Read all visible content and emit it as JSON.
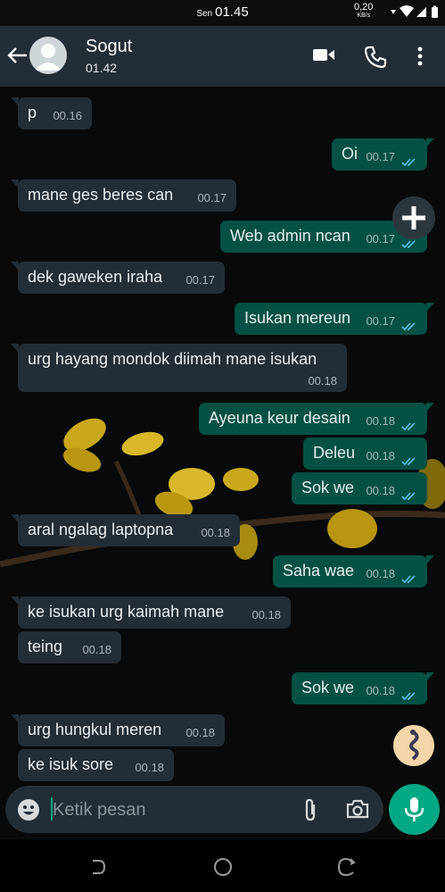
{
  "status_bar": {
    "day": "Sen",
    "time": "01.45",
    "speed_value": "0,20",
    "speed_unit": "KB/s"
  },
  "header": {
    "back_icon": "arrow-left-icon",
    "contact_name": "Sogut",
    "last_seen": "01.42",
    "icons": [
      "video-call-icon",
      "voice-call-icon",
      "more-vert-icon"
    ]
  },
  "messages": [
    {
      "dir": "in",
      "text": "p",
      "time": "00.16"
    },
    {
      "dir": "out",
      "text": "Oi",
      "time": "00.17",
      "read": true
    },
    {
      "dir": "in",
      "text": "mane ges beres can",
      "time": "00.17"
    },
    {
      "dir": "out",
      "text": "Web admin ncan",
      "time": "00.17",
      "read": true
    },
    {
      "dir": "in",
      "text": "dek gaweken iraha",
      "time": "00.17"
    },
    {
      "dir": "out",
      "text": "Isukan mereun",
      "time": "00.17",
      "read": true
    },
    {
      "dir": "in",
      "text": "urg hayang mondok diimah mane isukan",
      "time": "00.18"
    },
    {
      "dir": "out",
      "text": "Ayeuna keur desain",
      "time": "00.18",
      "read": true
    },
    {
      "dir": "out",
      "text": "Deleu",
      "time": "00.18",
      "read": true
    },
    {
      "dir": "out",
      "text": "Sok we",
      "time": "00.18",
      "read": true
    },
    {
      "dir": "in",
      "text": "aral ngalag laptopna",
      "time": "00.18"
    },
    {
      "dir": "out",
      "text": "Saha wae",
      "time": "00.18",
      "read": true
    },
    {
      "dir": "in",
      "text": "ke isukan urg kaimah mane",
      "time": "00.18"
    },
    {
      "dir": "in",
      "text": "teing",
      "time": "00.18"
    },
    {
      "dir": "out",
      "text": "Sok we",
      "time": "00.18",
      "read": true
    },
    {
      "dir": "in",
      "text": "urg hungkul meren",
      "time": "00.18"
    },
    {
      "dir": "in",
      "text": "ke isuk sore",
      "time": "00.18"
    }
  ],
  "composer": {
    "emoji_icon": "emoji-icon",
    "placeholder": "Ketik pesan",
    "attach_icon": "paperclip-icon",
    "camera_icon": "camera-icon",
    "mic_icon": "microphone-icon"
  },
  "floating": {
    "plus_icon": "plus-icon",
    "bot_icon": "assistant-bubble-icon"
  },
  "nav": [
    "recent-apps-icon",
    "home-icon",
    "back-nav-icon"
  ],
  "colors": {
    "header": "#232d36",
    "incoming": "#232d36",
    "outgoing": "#025144",
    "accent": "#00a884",
    "read_tick": "#53bdeb"
  }
}
